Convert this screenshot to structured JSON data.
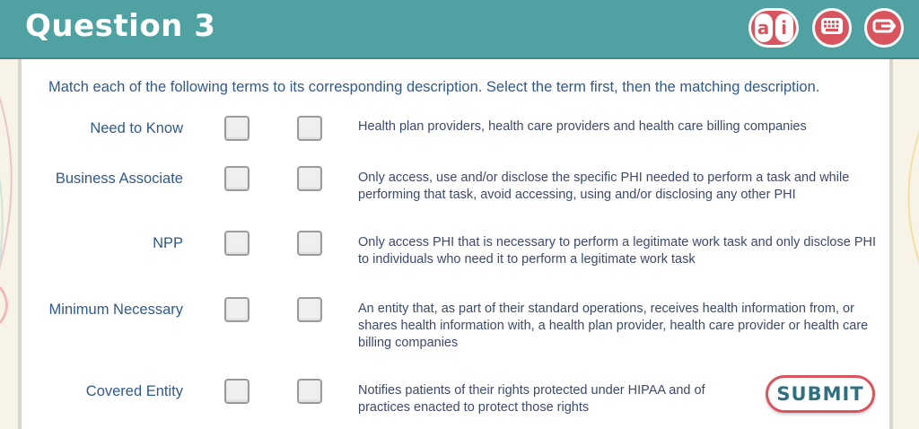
{
  "header": {
    "title": "Question 3",
    "tools": {
      "ai_letters": [
        "a",
        "i"
      ],
      "keyboard_icon": "keyboard-icon",
      "exit_icon": "exit-icon"
    },
    "colors": {
      "header_bg": "#4fa2a1",
      "accent": "#d8555f"
    }
  },
  "instructions": "Match each of the following terms to its corresponding description. Select the term first, then the matching description.",
  "terms": [
    {
      "label": "Need to Know"
    },
    {
      "label": "Business Associate"
    },
    {
      "label": "NPP"
    },
    {
      "label": "Minimum Necessary"
    },
    {
      "label": "Covered Entity"
    }
  ],
  "descriptions": [
    {
      "text": "Health plan providers, health care providers and health care billing companies"
    },
    {
      "text": "Only access, use and/or disclose the specific PHI needed to perform a task and while performing that task, avoid accessing, using and/or disclosing any other PHI"
    },
    {
      "text": "Only access PHI that is necessary to perform a legitimate work task and only disclose PHI to individuals who need it to perform a legitimate work task"
    },
    {
      "text": "An entity that, as part of their standard operations, receives health information from, or shares health information with, a health plan provider, health care provider or health care billing companies"
    },
    {
      "text": "Notifies patients of their rights protected under HIPAA and of practices enacted to protect those rights"
    }
  ],
  "submit_label": "SUBMIT"
}
